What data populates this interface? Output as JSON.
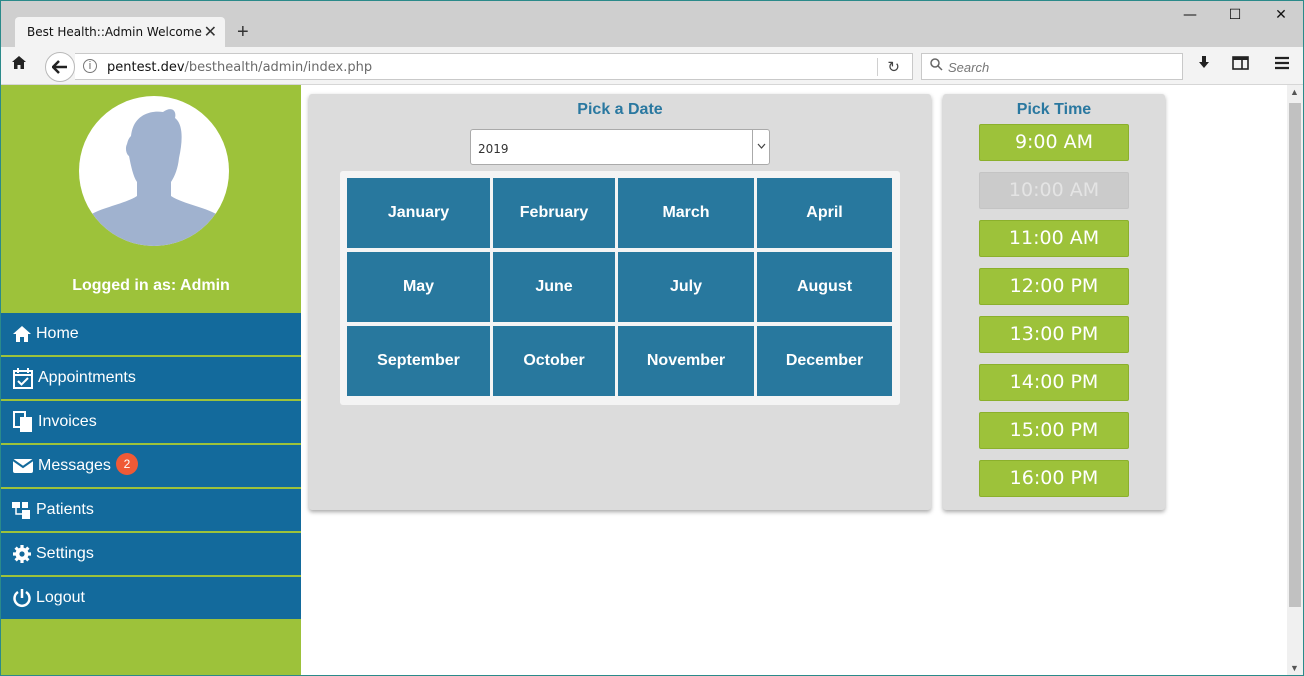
{
  "browser": {
    "tab_title": "Best Health::Admin Welcome",
    "url_host": "pentest.dev",
    "url_path": "/besthealth/admin/index.php",
    "search_placeholder": "Search"
  },
  "sidebar": {
    "logged_in_text": "Logged in as: Admin",
    "items": [
      {
        "label": "Home",
        "icon": "home-icon"
      },
      {
        "label": "Appointments",
        "icon": "calendar-check-icon"
      },
      {
        "label": "Invoices",
        "icon": "documents-icon"
      },
      {
        "label": "Messages",
        "icon": "envelope-icon",
        "badge": "2"
      },
      {
        "label": "Patients",
        "icon": "patients-icon"
      },
      {
        "label": "Settings",
        "icon": "gear-icon"
      },
      {
        "label": "Logout",
        "icon": "power-icon"
      }
    ]
  },
  "date_picker": {
    "title": "Pick a Date",
    "year": "2019",
    "months": [
      "January",
      "February",
      "March",
      "April",
      "May",
      "June",
      "July",
      "August",
      "September",
      "October",
      "November",
      "December"
    ]
  },
  "time_picker": {
    "title": "Pick Time",
    "slots": [
      {
        "label": "9:00 AM",
        "available": true
      },
      {
        "label": "10:00 AM",
        "available": false
      },
      {
        "label": "11:00 AM",
        "available": true
      },
      {
        "label": "12:00 PM",
        "available": true
      },
      {
        "label": "13:00 PM",
        "available": true
      },
      {
        "label": "14:00 PM",
        "available": true
      },
      {
        "label": "15:00 PM",
        "available": true
      },
      {
        "label": "16:00 PM",
        "available": true
      }
    ]
  },
  "colors": {
    "sidebar_green": "#9dc23a",
    "menu_blue": "#136a9c",
    "month_blue": "#28789e",
    "badge_red": "#ef5a36",
    "title_blue": "#2a78a0"
  }
}
